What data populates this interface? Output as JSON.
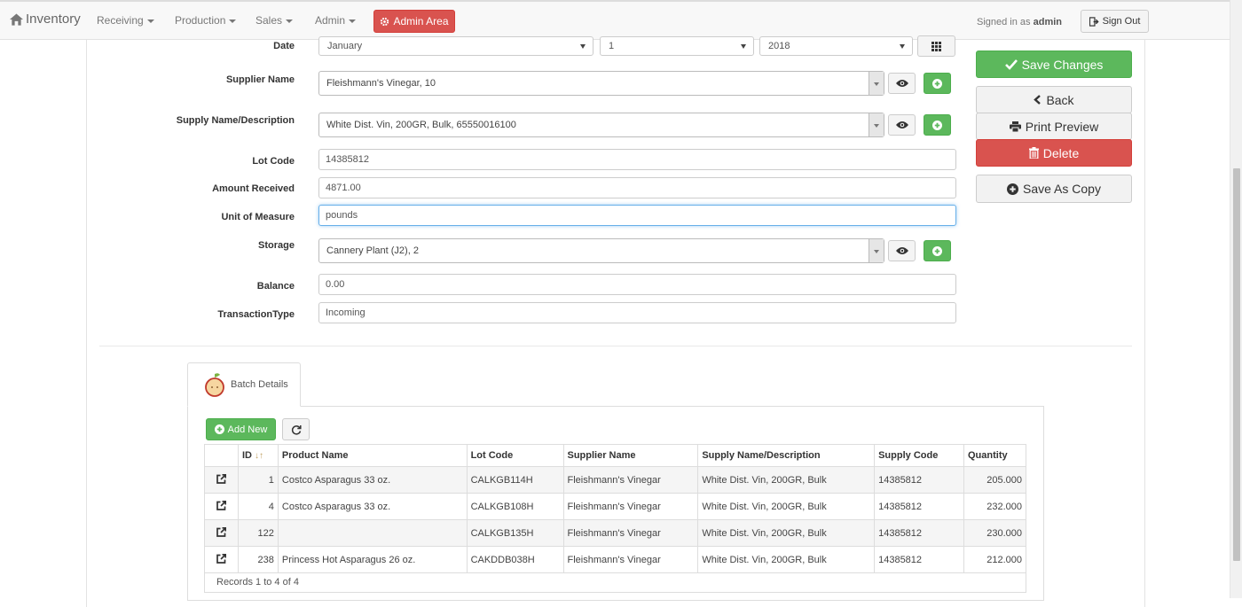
{
  "navbar": {
    "brand": "Inventory",
    "menus": [
      {
        "label": "Receiving"
      },
      {
        "label": "Production"
      },
      {
        "label": "Sales"
      },
      {
        "label": "Admin"
      }
    ],
    "admin_area": "Admin Area",
    "signed_in_prefix": "Signed in as",
    "user": "admin",
    "sign_out": "Sign Out"
  },
  "form": {
    "date": {
      "label": "Date",
      "month": "January",
      "day": "1",
      "year": "2018"
    },
    "supplier": {
      "label": "Supplier Name",
      "value": "Fleishmann's Vinegar, 10"
    },
    "supply": {
      "label": "Supply Name/Description",
      "value": "White Dist. Vin, 200GR, Bulk, 65550016100"
    },
    "lot_code": {
      "label": "Lot Code",
      "value": "14385812"
    },
    "amount": {
      "label": "Amount Received",
      "value": "4871.00"
    },
    "unit": {
      "label": "Unit of Measure",
      "value": "pounds"
    },
    "storage": {
      "label": "Storage",
      "value": "Cannery Plant (J2), 2"
    },
    "balance": {
      "label": "Balance",
      "value": "0.00"
    },
    "transaction": {
      "label": "TransactionType",
      "value": "Incoming"
    }
  },
  "actions": {
    "save": "Save Changes",
    "back": "Back",
    "print": "Print Preview",
    "delete": "Delete",
    "save_copy": "Save As Copy"
  },
  "batch": {
    "tab_label": "Batch Details",
    "add_new": "Add New",
    "columns": [
      "ID",
      "Product Name",
      "Lot Code",
      "Supplier Name",
      "Supply Name/Description",
      "Supply Code",
      "Quantity"
    ],
    "rows": [
      {
        "id": "1",
        "product": "Costco Asparagus 33 oz.",
        "lot": "CALKGB114H",
        "supplier": "Fleishmann's Vinegar",
        "supply": "White Dist. Vin, 200GR, Bulk",
        "code": "14385812",
        "qty": "205.000"
      },
      {
        "id": "4",
        "product": "Costco Asparagus 33 oz.",
        "lot": "CALKGB108H",
        "supplier": "Fleishmann's Vinegar",
        "supply": "White Dist. Vin, 200GR, Bulk",
        "code": "14385812",
        "qty": "232.000"
      },
      {
        "id": "122",
        "product": "",
        "lot": "CALKGB135H",
        "supplier": "Fleishmann's Vinegar",
        "supply": "White Dist. Vin, 200GR, Bulk",
        "code": "14385812",
        "qty": "230.000"
      },
      {
        "id": "238",
        "product": "Princess Hot Asparagus 26 oz.",
        "lot": "CAKDDB038H",
        "supplier": "Fleishmann's Vinegar",
        "supply": "White Dist. Vin, 200GR, Bulk",
        "code": "14385812",
        "qty": "212.000"
      }
    ],
    "records": "Records 1 to 4 of 4"
  },
  "colors": {
    "success": "#5cb85c",
    "danger": "#d9534f",
    "focus": "#66afe9"
  }
}
